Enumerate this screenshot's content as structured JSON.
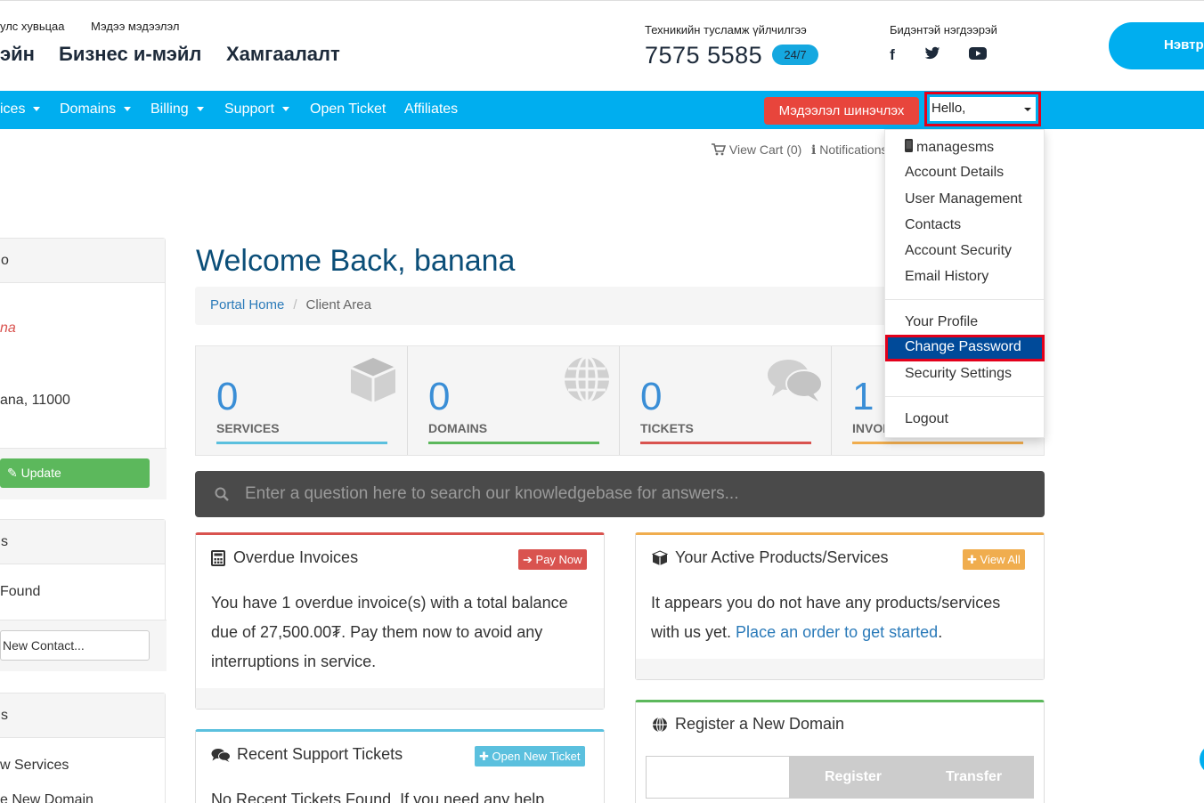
{
  "header": {
    "small_links": [
      "улс хувьцаа",
      "Мэдээ мэдээлэл"
    ],
    "big_links": [
      "эйн",
      "Бизнес и-мэйл",
      "Хамгаалалт"
    ],
    "support_label": "Техникийн тусламж үйлчилгээ",
    "phone": "7575 5585",
    "badge": "24/7",
    "contact_label": "Бидэнтэй нэгдээрэй",
    "social": [
      {
        "name": "facebook",
        "glyph": "f"
      },
      {
        "name": "twitter",
        "glyph": "t"
      },
      {
        "name": "youtube",
        "glyph": "y"
      }
    ],
    "login_label": "Нэвтрэх"
  },
  "nav": {
    "items": [
      {
        "label": "ices",
        "has_caret": true
      },
      {
        "label": "Domains",
        "has_caret": true
      },
      {
        "label": "Billing",
        "has_caret": true
      },
      {
        "label": "Support",
        "has_caret": true
      },
      {
        "label": "Open Ticket",
        "has_caret": false
      },
      {
        "label": "Affiliates",
        "has_caret": false
      }
    ],
    "update_info_label": "Мэдээлэл шинэчлэх",
    "hello_label": "Hello,"
  },
  "cart": {
    "view_cart": "View Cart (0)",
    "notifications": "Notifications"
  },
  "user_menu": {
    "items": [
      "managesms",
      "Account Details",
      "User Management",
      "Contacts",
      "Account Security",
      "Email History",
      "Your Profile",
      "Change Password",
      "Security Settings",
      "Logout"
    ],
    "active": "Change Password"
  },
  "sidebar": {
    "info_title": "o",
    "info_name": "na",
    "info_address": "ana, 11000",
    "update_label": "Update",
    "contacts_title": "s",
    "contacts_empty": "Found",
    "new_contact": "New Contact...",
    "shortcuts_title": "s",
    "shortcut_1": "w Services",
    "shortcut_2": "e New Domain"
  },
  "main": {
    "welcome": "Welcome Back, banana",
    "breadcrumb": {
      "home": "Portal Home",
      "current": "Client Area"
    },
    "tiles": [
      {
        "count": "0",
        "label": "SERVICES",
        "color": "#5bc0de"
      },
      {
        "count": "0",
        "label": "DOMAINS",
        "color": "#5cb85c"
      },
      {
        "count": "0",
        "label": "TICKETS",
        "color": "#d9534f"
      },
      {
        "count": "1",
        "label": "INVOI",
        "color": "#f0ad4e"
      }
    ],
    "kb_placeholder": "Enter a question here to search our knowledgebase for answers...",
    "overdue": {
      "title": "Overdue Invoices",
      "button": "Pay Now",
      "line1": "You have 1 overdue invoice(s) with a total balance",
      "line2": "due of 27,500.00₮. Pay them now to avoid any",
      "line3": "interruptions in service."
    },
    "products": {
      "title": "Your Active Products/Services",
      "button": "View All",
      "line1": "It appears you do not have any products/services",
      "line2_prefix": "with us yet. ",
      "link": "Place an order to get started",
      "line2_suffix": "."
    },
    "domain": {
      "title": "Register a New Domain",
      "register": "Register",
      "transfer": "Transfer"
    },
    "tickets": {
      "title": "Recent Support Tickets",
      "button": "Open New Ticket",
      "text": "No Recent Tickets Found. If you need any help,"
    }
  },
  "colors": {
    "brand": "#00aeef",
    "danger": "#e8453c",
    "highlight": "#e3001b",
    "heading": "#0b4e78"
  }
}
